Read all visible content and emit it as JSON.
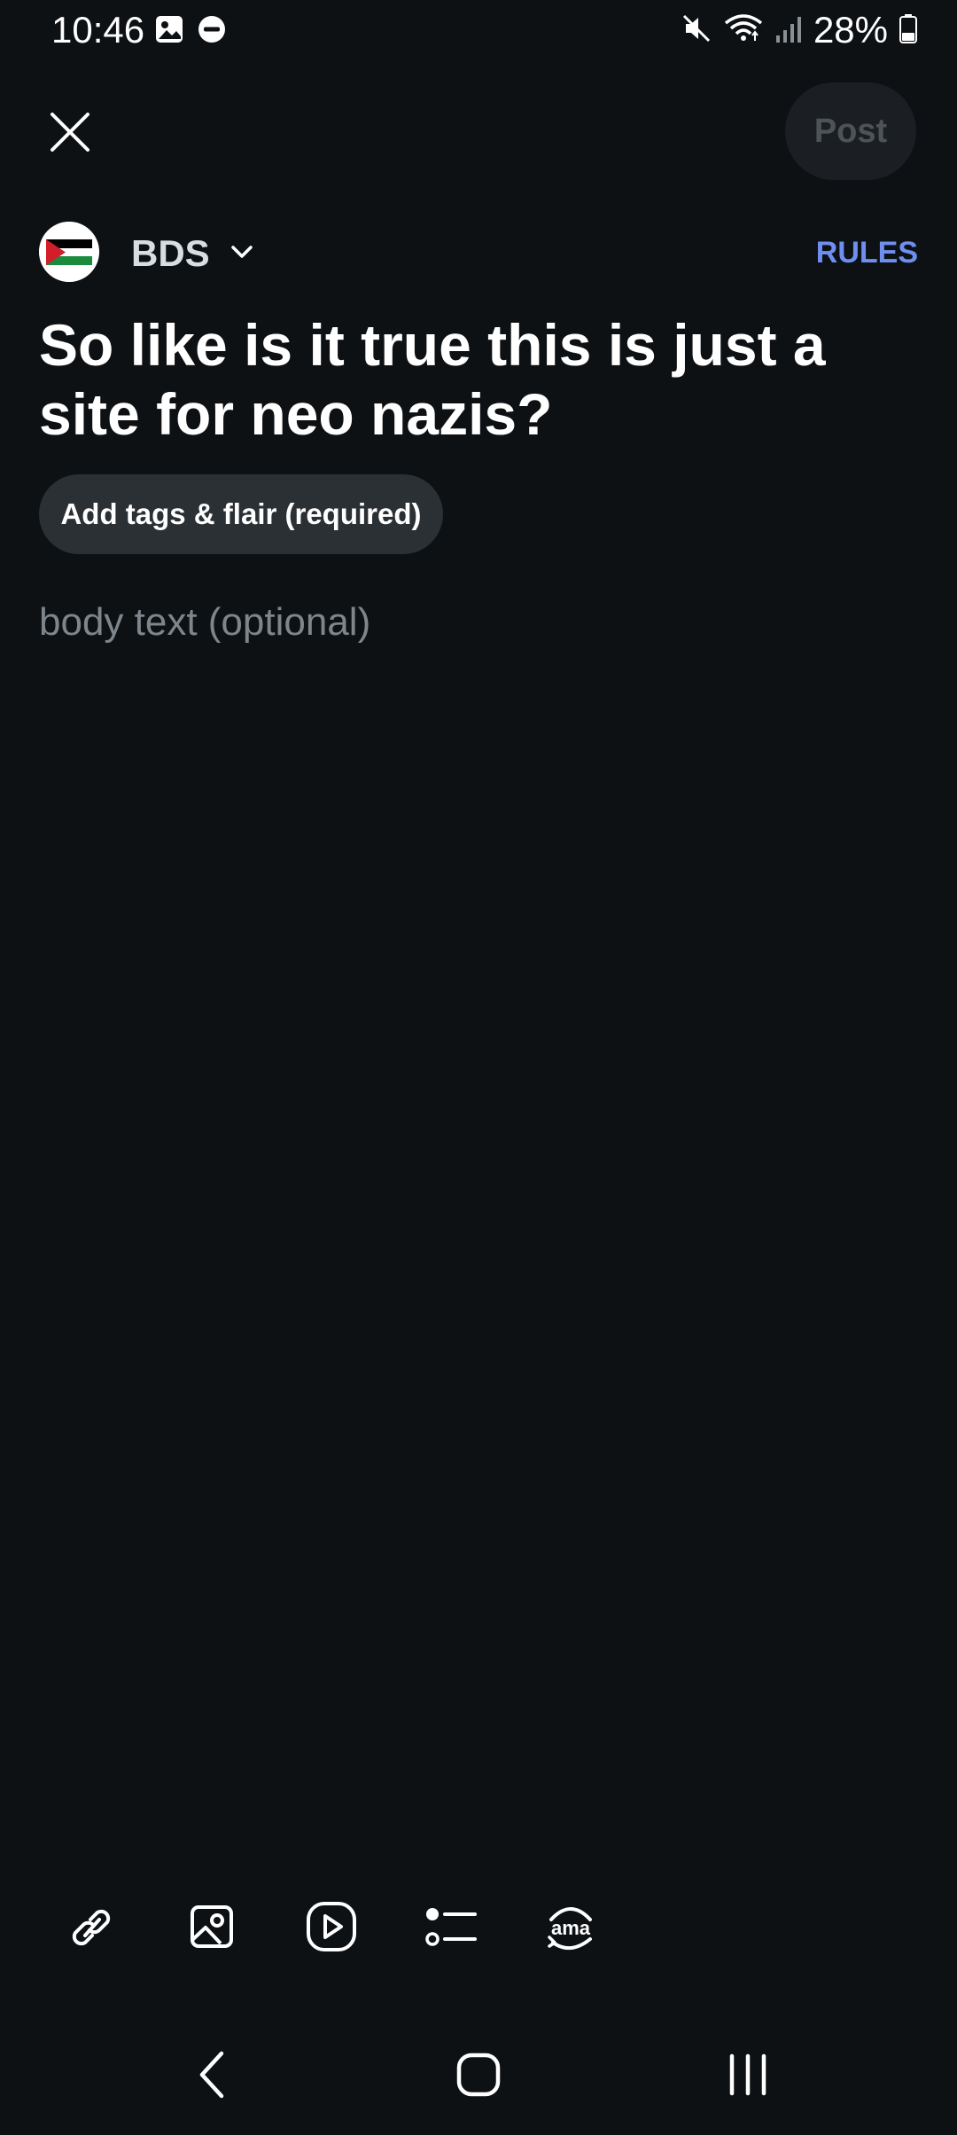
{
  "status_bar": {
    "time": "10:46",
    "battery_percent": "28%",
    "left_icons": [
      "image-icon",
      "do-not-disturb-icon"
    ],
    "right_icons": [
      "mute-icon",
      "wifi-icon",
      "signal-icon",
      "battery-icon"
    ]
  },
  "header": {
    "close_icon": "close-icon",
    "post_label": "Post",
    "post_enabled": false
  },
  "community": {
    "name": "BDS",
    "avatar_icon": "palestine-flag-icon",
    "rules_label": "RULES"
  },
  "post": {
    "title": "So like is it true this is just a site for neo nazis?",
    "tags_label": "Add tags & flair (required)",
    "body_placeholder": "body text (optional)",
    "body_value": ""
  },
  "toolbar": {
    "items": [
      "link-icon",
      "image-icon",
      "video-icon",
      "list-icon",
      "ama-icon"
    ]
  },
  "nav_bar": {
    "items": [
      "back-icon",
      "home-icon",
      "recents-icon"
    ]
  },
  "colors": {
    "background": "#0e1114",
    "accent": "#6f8ff0",
    "chip_bg": "#2b3034",
    "post_disabled_bg": "#1b1f23",
    "post_disabled_text": "#4e5358",
    "placeholder": "#7e868c"
  }
}
